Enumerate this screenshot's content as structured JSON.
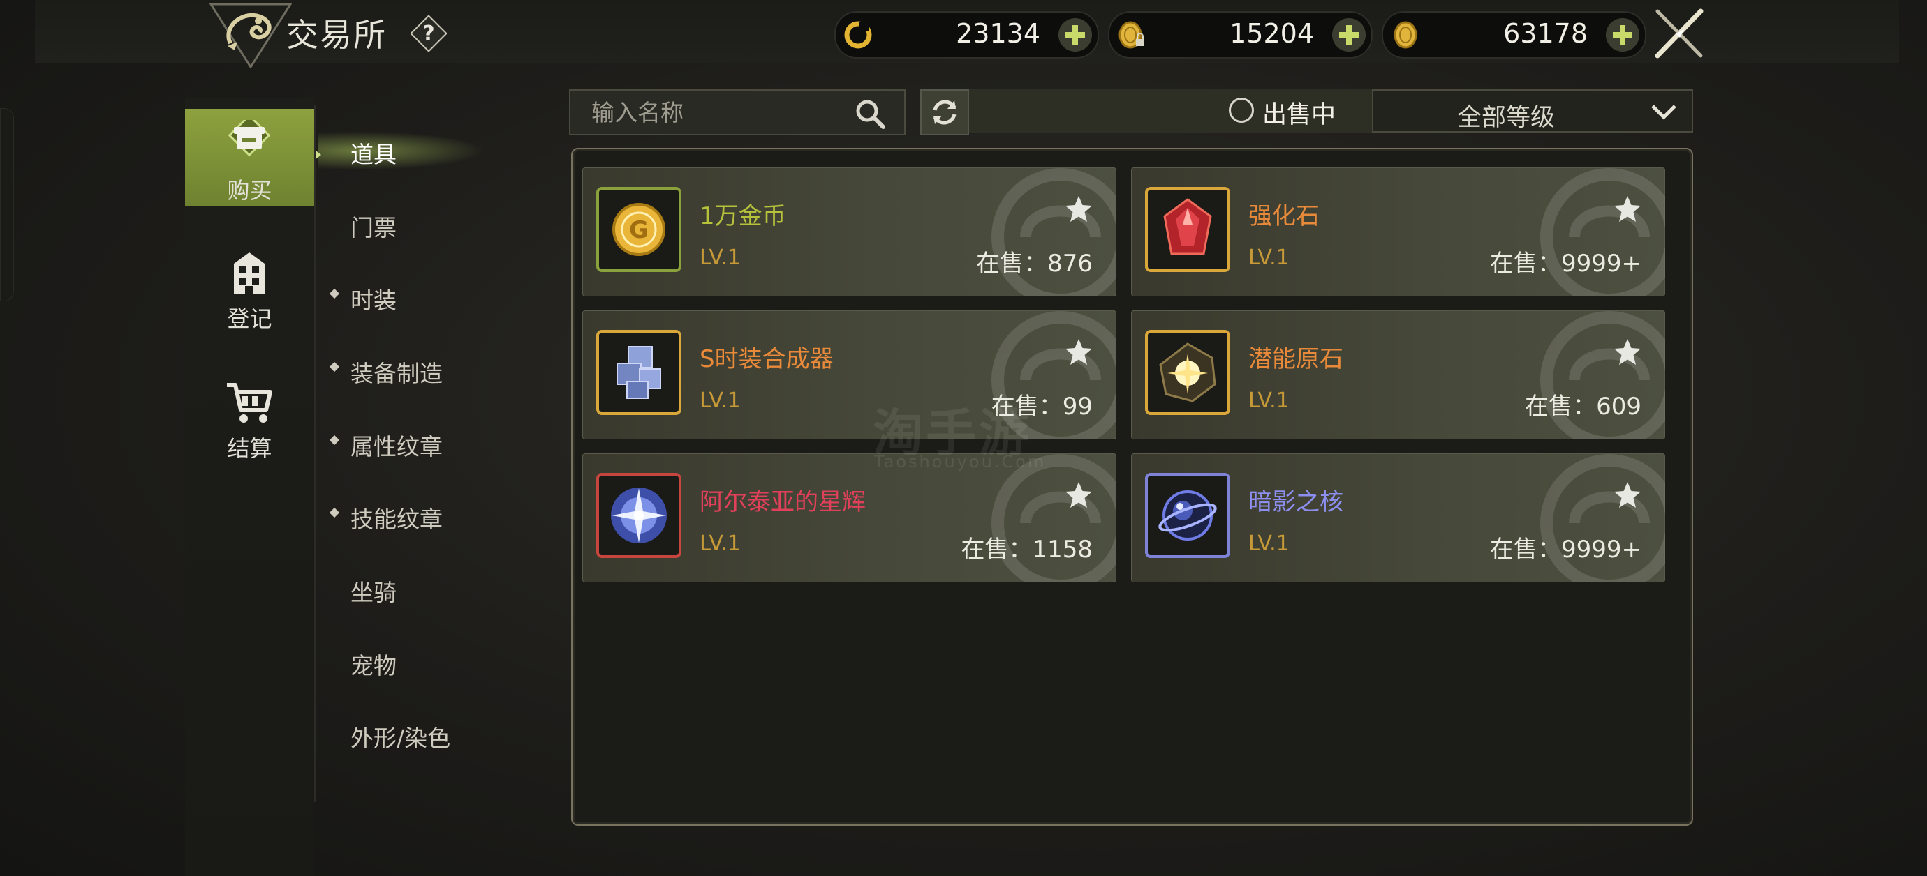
{
  "header": {
    "title": "交易所",
    "currencies": [
      {
        "icon": "ring-token-icon",
        "amount": "23134"
      },
      {
        "icon": "locked-gold-coin-icon",
        "amount": "15204"
      },
      {
        "icon": "gold-coin-icon",
        "amount": "63178"
      }
    ]
  },
  "rail": {
    "items": [
      {
        "label": "购买",
        "active": true
      },
      {
        "label": "登记",
        "active": false
      },
      {
        "label": "结算",
        "active": false
      }
    ]
  },
  "categories": [
    {
      "label": "道具",
      "active": true,
      "bullet": false
    },
    {
      "label": "门票",
      "active": false,
      "bullet": false
    },
    {
      "label": "时装",
      "active": false,
      "bullet": true
    },
    {
      "label": "装备制造",
      "active": false,
      "bullet": true
    },
    {
      "label": "属性纹章",
      "active": false,
      "bullet": true
    },
    {
      "label": "技能纹章",
      "active": false,
      "bullet": true
    },
    {
      "label": "坐骑",
      "active": false,
      "bullet": false
    },
    {
      "label": "宠物",
      "active": false,
      "bullet": false
    },
    {
      "label": "外形/染色",
      "active": false,
      "bullet": false
    }
  ],
  "search": {
    "placeholder": "输入名称"
  },
  "filter": {
    "on_sale_label": "出售中",
    "level_value": "全部等级"
  },
  "items": [
    {
      "name": "1万金币",
      "level": "LV.1",
      "sale": "在售：876",
      "name_color": "#b7c23b",
      "frame_color": "#8aa13c",
      "icon": "gold-coin-item-icon"
    },
    {
      "name": "强化石",
      "level": "LV.1",
      "sale": "在售：9999+",
      "name_color": "#e98a3a",
      "frame_color": "#d9a73a",
      "icon": "red-crystal-icon"
    },
    {
      "name": "S时装合成器",
      "level": "LV.1",
      "sale": "在售：99",
      "name_color": "#e98a3a",
      "frame_color": "#d9a73a",
      "icon": "blue-cube-icon"
    },
    {
      "name": "潜能原石",
      "level": "LV.1",
      "sale": "在售：609",
      "name_color": "#e98a3a",
      "frame_color": "#d9a73a",
      "icon": "potential-stone-icon"
    },
    {
      "name": "阿尔泰亚的星辉",
      "level": "LV.1",
      "sale": "在售：1158",
      "name_color": "#e0405a",
      "frame_color": "#c6453e",
      "icon": "star-radiance-icon"
    },
    {
      "name": "暗影之核",
      "level": "LV.1",
      "sale": "在售：9999+",
      "name_color": "#8d8ff0",
      "frame_color": "#7f83d8",
      "icon": "shadow-core-icon"
    }
  ],
  "watermark": {
    "text": "淘手游",
    "sub": "Taoshouyou.Com"
  }
}
